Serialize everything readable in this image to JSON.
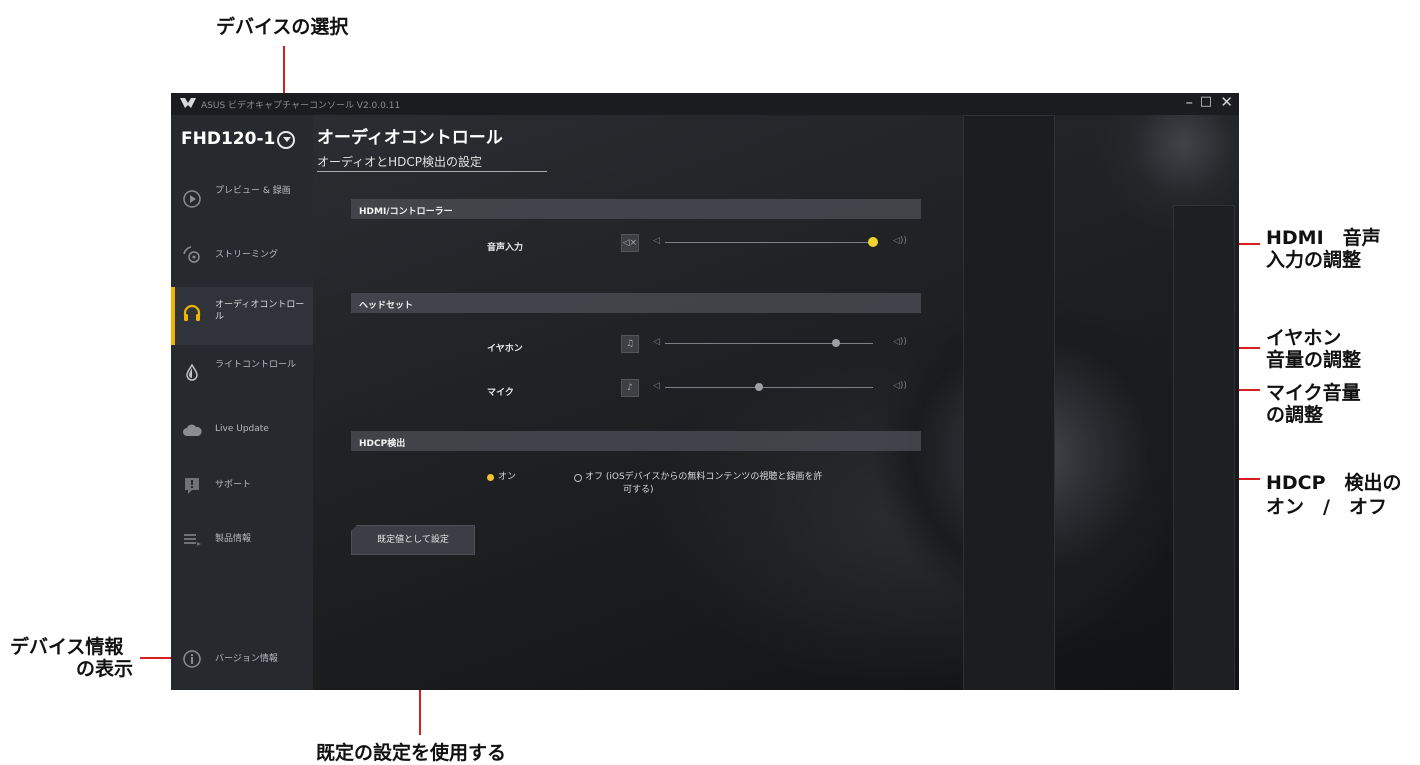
{
  "annotations": {
    "device_select": "デバイスの選択",
    "hdmi_line1": "HDMI　音声",
    "hdmi_line2": "入力の調整",
    "earphone_line1": "イヤホン",
    "earphone_line2": "音量の調整",
    "mic_line1": "マイク音量",
    "mic_line2": "の調整",
    "hdcp_line1": "HDCP　検出の",
    "hdcp_line2": "オン　/　オフ",
    "device_info_line1": "デバイス情報",
    "device_info_line2": "の表示",
    "use_default": "既定の設定を使用する"
  },
  "window": {
    "title": "ASUS ビデオキャプチャーコンソール V2.0.0.11",
    "minimize": "–",
    "maximize": "□",
    "close": "✕"
  },
  "sidebar": {
    "device_name": "FHD120-1",
    "items": [
      {
        "label": "プレビュー & 録画",
        "icon": "play-icon"
      },
      {
        "label": "ストリーミング",
        "icon": "streaming-icon"
      },
      {
        "label": "オーディオコントロール",
        "icon": "headphones-icon",
        "active": true
      },
      {
        "label": "ライトコントロール",
        "icon": "light-drop-icon"
      },
      {
        "label": "Live Update",
        "icon": "cloud-icon"
      },
      {
        "label": "サポート",
        "icon": "support-icon"
      },
      {
        "label": "製品情報",
        "icon": "menu-lines-icon"
      }
    ],
    "version": {
      "label": "バージョン情報",
      "icon": "info-icon"
    }
  },
  "main": {
    "title": "オーディオコントロール",
    "subtitle": "オーディオとHDCP検出の設定",
    "hdmi_section": "HDMI/コントローラー",
    "audio_input_label": "音声入力",
    "headset_section": "ヘッドセット",
    "earphone_label": "イヤホン",
    "mic_label": "マイク",
    "hdcp_section": "HDCP検出",
    "hdcp_on_label": "オン",
    "hdcp_off_label_1": "オフ (iOSデバイスからの無料コンテンツの視聴と録画を許",
    "hdcp_off_label_2": "可する)",
    "hdcp_selected": "on",
    "default_button": "既定値として設定"
  },
  "levels": {
    "audio_input": 1.0,
    "earphone": 0.82,
    "mic": 0.45
  },
  "colors": {
    "accent": "#f2d230",
    "callout_line": "#d81e1e"
  }
}
